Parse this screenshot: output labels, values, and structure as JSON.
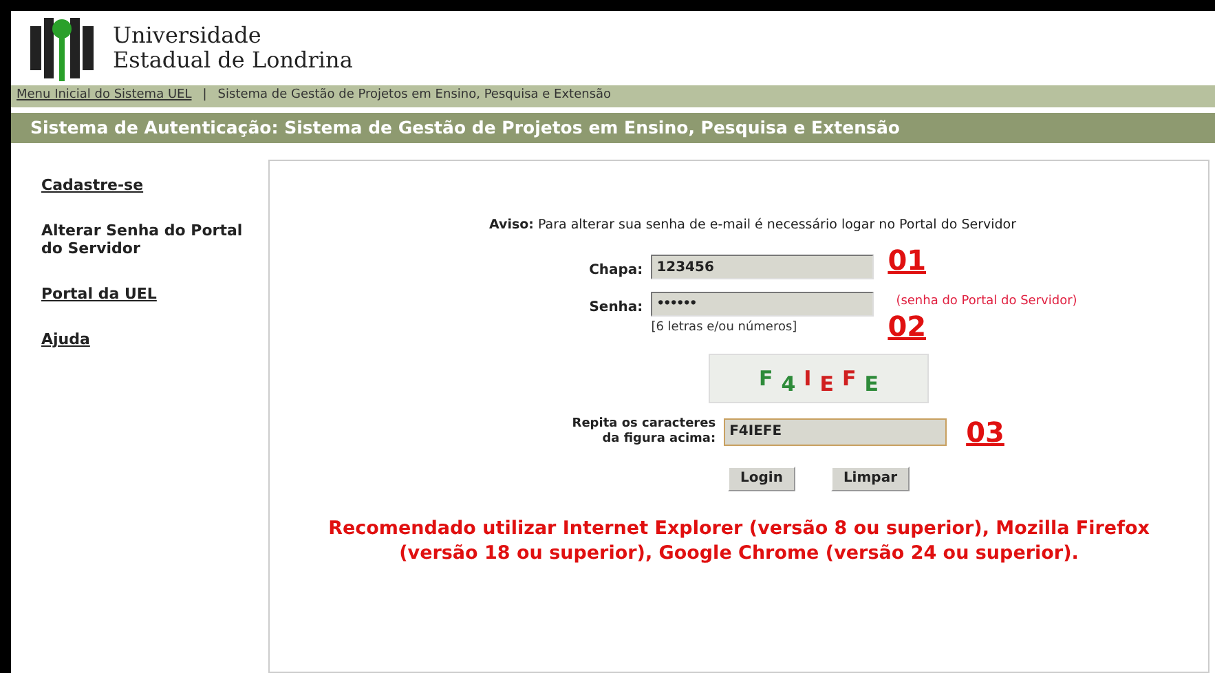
{
  "header": {
    "logo_line_1": "Universidade",
    "logo_line_2": "Estadual de Londrina"
  },
  "breadcrumb": [
    "Menu Inicial do Sistema UEL",
    "|",
    "Sistema de Gestão de Projetos em Ensino, Pesquisa e Extensão"
  ],
  "title_bar": "Sistema de Autenticação: Sistema de Gestão de Projetos em Ensino, Pesquisa e Extensão",
  "sidebar": {
    "items": [
      {
        "label": "Cadastre-se",
        "link": true
      },
      {
        "label": "Alterar Senha do Portal do Servidor",
        "link": false
      },
      {
        "label": "Portal da UEL",
        "link": true
      },
      {
        "label": "Ajuda",
        "link": true
      }
    ]
  },
  "form": {
    "notice": "**Aviso:** Para alterar sua senha de e-mail é necessário logar no Portal do Servidor",
    "fields": [
      {
        "kind": "text",
        "label": "Chapa:",
        "value": "123456",
        "marker": "01"
      },
      {
        "kind": "password",
        "label": "Senha:",
        "value": "••••••",
        "note": "(senha do Portal do Servidor)",
        "hint": "[6 letras e/ou números]",
        "marker": "02"
      }
    ],
    "captcha": [
      {
        "text": "F",
        "color": "#2e8b3a"
      },
      {
        "text": "4",
        "color": "#2e8b3a"
      },
      {
        "text": "I",
        "color": "#d02020"
      },
      {
        "text": "E",
        "color": "#d02020"
      },
      {
        "text": "F",
        "color": "#d02020"
      },
      {
        "text": "E",
        "color": "#2e8b3a"
      }
    ],
    "captcha_field": {
      "label_1": "Repita os caracteres",
      "label_2": "da figura acima:",
      "value": "F4IEFE",
      "marker": "03"
    },
    "buttons": [
      "Login",
      "Limpar"
    ],
    "recommendation": "Recomendado utilizar Internet Explorer (versão 8 ou superior), Mozilla Firefox (versão 18 ou superior), Google Chrome (versão 24 ou superior)."
  }
}
